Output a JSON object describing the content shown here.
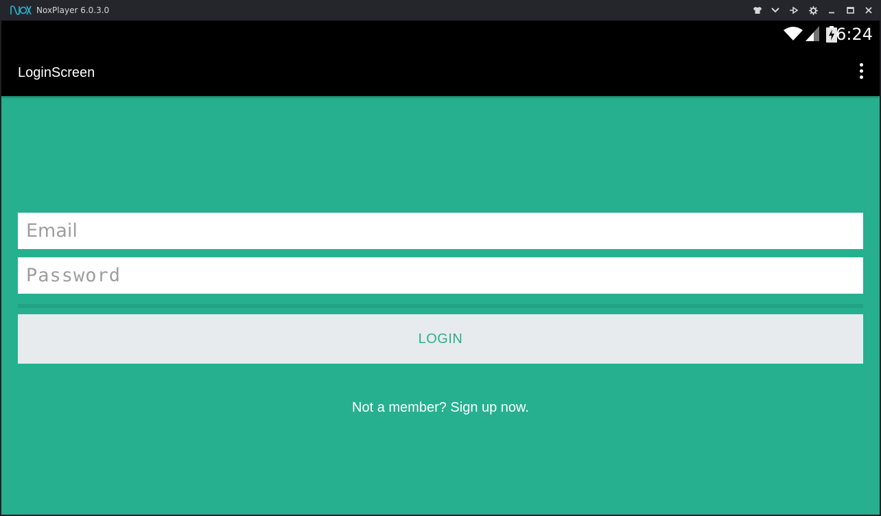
{
  "window": {
    "logo_text": "nox",
    "title": "NoxPlayer 6.0.3.0",
    "controls": [
      "shirt-icon",
      "chevron-down-icon",
      "pin-icon",
      "gear-icon",
      "minimize-icon",
      "maximize-icon",
      "close-icon"
    ]
  },
  "statusbar": {
    "time": "6:24",
    "icons": [
      "wifi-icon",
      "signal-icon",
      "battery-charging-icon"
    ]
  },
  "appbar": {
    "title": "LoginScreen",
    "menu_icon": "overflow-menu-icon"
  },
  "form": {
    "email_placeholder": "Email",
    "email_value": "",
    "password_placeholder": "Password",
    "password_value": "",
    "login_label": "LOGIN",
    "signup_text": "Not a member? Sign up now."
  },
  "colors": {
    "accent": "#26b08f",
    "appbar": "#000000",
    "button_bg": "#e8ebee",
    "titlebar": "#25262b"
  }
}
